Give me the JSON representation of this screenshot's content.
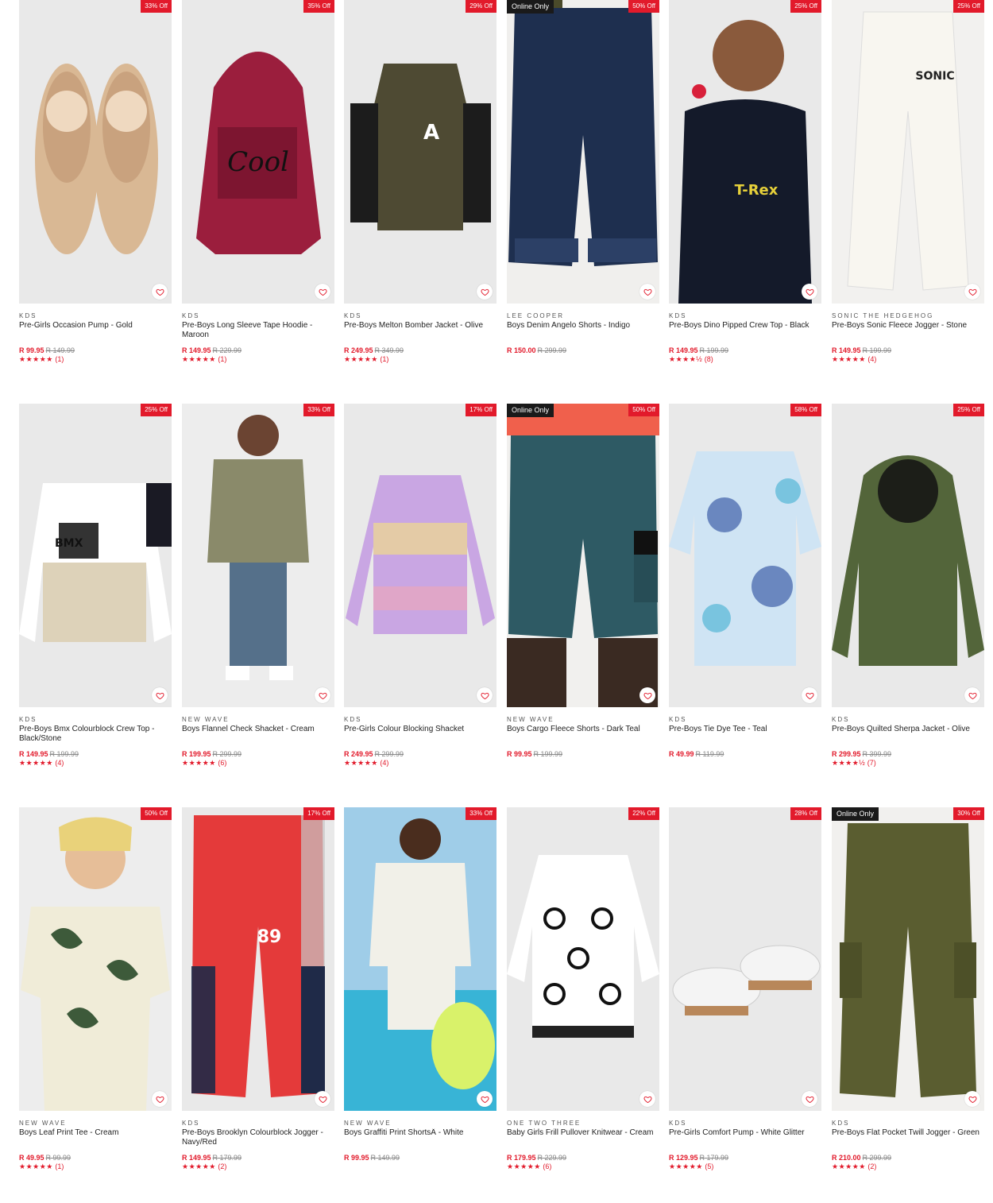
{
  "colors": {
    "accent": "#e21a2b",
    "online_badge": "#1a1a1a"
  },
  "products": [
    {
      "badge": "33% Off",
      "online": "",
      "brand": "KDS",
      "name": "Pre-Girls Occasion Pump - Gold",
      "price": "R 99.95",
      "was": "R 149.99",
      "stars": "★★★★★",
      "reviews": "(1)"
    },
    {
      "badge": "35% Off",
      "online": "",
      "brand": "KDS",
      "name": "Pre-Boys Long Sleeve Tape Hoodie - Maroon",
      "price": "R 149.95",
      "was": "R 229.99",
      "stars": "★★★★★",
      "reviews": "(1)"
    },
    {
      "badge": "29% Off",
      "online": "",
      "brand": "KDS",
      "name": "Pre-Boys Melton Bomber Jacket - Olive",
      "price": "R 249.95",
      "was": "R 349.99",
      "stars": "★★★★★",
      "reviews": "(1)"
    },
    {
      "badge": "50% Off",
      "online": "Online Only",
      "brand": "LEE COOPER",
      "name": "Boys Denim Angelo Shorts - Indigo",
      "price": "R 150.00",
      "was": "R 299.99",
      "stars": "",
      "reviews": ""
    },
    {
      "badge": "25% Off",
      "online": "",
      "brand": "KDS",
      "name": "Pre-Boys Dino Pipped Crew Top - Black",
      "price": "R 149.95",
      "was": "R 199.99",
      "stars": "★★★★½",
      "reviews": "(8)"
    },
    {
      "badge": "25% Off",
      "online": "",
      "brand": "SONIC THE HEDGEHOG",
      "name": "Pre-Boys Sonic Fleece Jogger - Stone",
      "price": "R 149.95",
      "was": "R 199.99",
      "stars": "★★★★★",
      "reviews": "(4)"
    },
    {
      "badge": "25% Off",
      "online": "",
      "brand": "KDS",
      "name": "Pre-Boys Bmx Colourblock Crew Top - Black/Stone",
      "price": "R 149.95",
      "was": "R 199.99",
      "stars": "★★★★★",
      "reviews": "(4)"
    },
    {
      "badge": "33% Off",
      "online": "",
      "brand": "NEW WAVE",
      "name": "Boys Flannel Check Shacket - Cream",
      "price": "R 199.95",
      "was": "R 299.99",
      "stars": "★★★★★",
      "reviews": "(6)"
    },
    {
      "badge": "17% Off",
      "online": "",
      "brand": "KDS",
      "name": "Pre-Girls Colour Blocking Shacket",
      "price": "R 249.95",
      "was": "R 299.99",
      "stars": "★★★★★",
      "reviews": "(4)"
    },
    {
      "badge": "50% Off",
      "online": "Online Only",
      "brand": "NEW WAVE",
      "name": "Boys Cargo Fleece Shorts - Dark Teal",
      "price": "R 99.95",
      "was": "R 199.99",
      "stars": "",
      "reviews": ""
    },
    {
      "badge": "58% Off",
      "online": "",
      "brand": "KDS",
      "name": "Pre-Boys Tie Dye Tee - Teal",
      "price": "R 49.99",
      "was": "R 119.99",
      "stars": "",
      "reviews": ""
    },
    {
      "badge": "25% Off",
      "online": "",
      "brand": "KDS",
      "name": "Pre-Boys Quilted Sherpa Jacket - Olive",
      "price": "R 299.95",
      "was": "R 399.99",
      "stars": "★★★★½",
      "reviews": "(7)"
    },
    {
      "badge": "50% Off",
      "online": "",
      "brand": "NEW WAVE",
      "name": "Boys Leaf Print Tee - Cream",
      "price": "R 49.95",
      "was": "R 99.99",
      "stars": "★★★★★",
      "reviews": "(1)"
    },
    {
      "badge": "17% Off",
      "online": "",
      "brand": "KDS",
      "name": "Pre-Boys Brooklyn Colourblock Jogger - Navy/Red",
      "price": "R 149.95",
      "was": "R 179.99",
      "stars": "★★★★★",
      "reviews": "(2)"
    },
    {
      "badge": "33% Off",
      "online": "",
      "brand": "NEW WAVE",
      "name": "Boys Graffiti Print ShortsÂ - White",
      "price": "R 99.95",
      "was": "R 149.99",
      "stars": "",
      "reviews": ""
    },
    {
      "badge": "22% Off",
      "online": "",
      "brand": "ONE TWO THREE",
      "name": "Baby Girls Frill Pullover Knitwear - Cream",
      "price": "R 179.95",
      "was": "R 229.99",
      "stars": "★★★★★",
      "reviews": "(6)"
    },
    {
      "badge": "28% Off",
      "online": "",
      "brand": "KDS",
      "name": "Pre-Girls Comfort Pump - White Glitter",
      "price": "R 129.95",
      "was": "R 179.99",
      "stars": "★★★★★",
      "reviews": "(5)"
    },
    {
      "badge": "30% Off",
      "online": "Online Only",
      "brand": "KDS",
      "name": "Pre-Boys Flat Pocket Twill Jogger - Green",
      "price": "R 210.00",
      "was": "R 299.99",
      "stars": "★★★★★",
      "reviews": "(2)"
    }
  ]
}
